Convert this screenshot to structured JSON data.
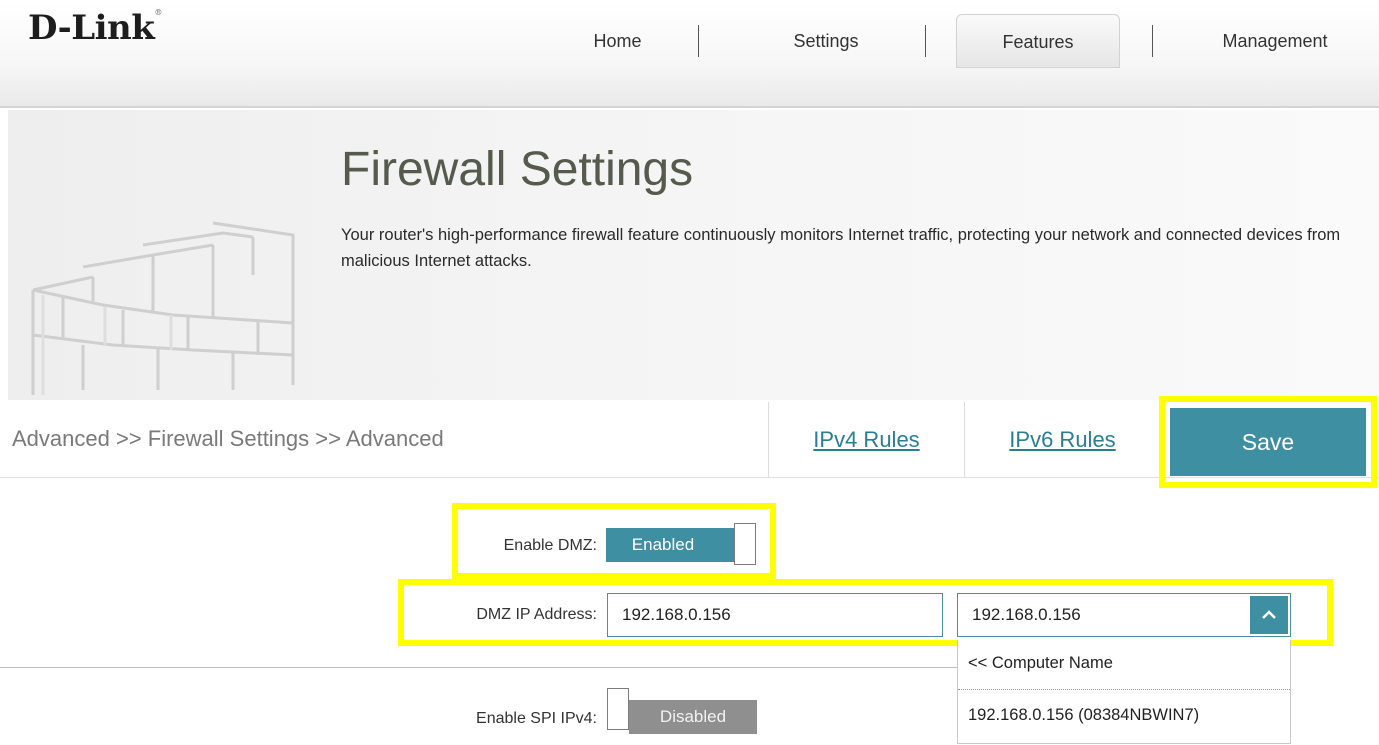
{
  "header": {
    "logo": "D-Link",
    "logo_mark": "®",
    "nav": [
      {
        "label": "Home",
        "active": false
      },
      {
        "label": "Settings",
        "active": false
      },
      {
        "label": "Features",
        "active": true
      },
      {
        "label": "Management",
        "active": false
      }
    ]
  },
  "banner": {
    "title": "Firewall Settings",
    "description": "Your router's high-performance firewall feature continuously monitors Internet traffic, protecting your network and connected devices from malicious Internet attacks.",
    "icon": "brick-wall-icon"
  },
  "subbar": {
    "breadcrumb": "Advanced >> Firewall Settings >> Advanced",
    "ipv4_rules": "IPv4 Rules",
    "ipv6_rules": "IPv6 Rules",
    "save": "Save"
  },
  "form": {
    "enable_dmz_label": "Enable DMZ:",
    "enable_dmz_state": "Enabled",
    "dmz_ip_label": "DMZ IP Address:",
    "dmz_ip_value": "192.168.0.156",
    "computer_select_value": "192.168.0.156",
    "dropdown_options": [
      "<< Computer Name",
      "192.168.0.156 (08384NBWIN7)"
    ],
    "enable_spi_ipv4_label": "Enable SPI IPv4:",
    "enable_spi_ipv4_state": "Disabled"
  },
  "colors": {
    "accent": "#3f8fa3",
    "link": "#287f94",
    "highlight": "#ffff00",
    "disabled": "#8f8f8f"
  }
}
